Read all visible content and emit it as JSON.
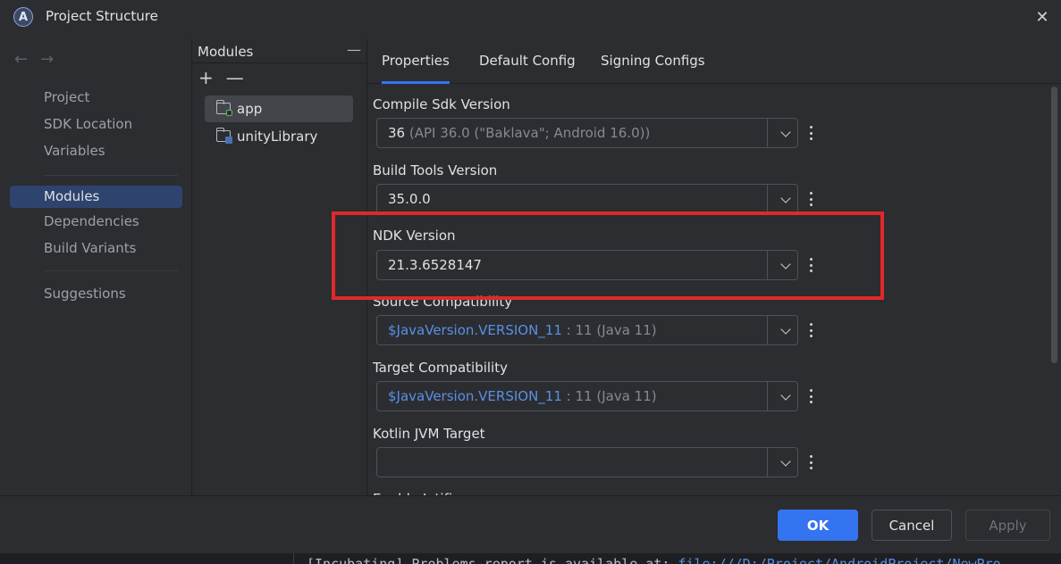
{
  "window": {
    "title": "Project Structure",
    "logo_glyph": "A"
  },
  "nav": {
    "back_glyph": "←",
    "forward_glyph": "→",
    "items": [
      {
        "label": "Project"
      },
      {
        "label": "SDK Location"
      },
      {
        "label": "Variables"
      },
      {
        "label": "Modules",
        "selected": true
      },
      {
        "label": "Dependencies"
      },
      {
        "label": "Build Variants"
      },
      {
        "label": "Suggestions"
      }
    ]
  },
  "modules": {
    "header": "Modules",
    "add_glyph": "+",
    "remove_glyph": "—",
    "minimize_glyph": "—",
    "items": [
      {
        "label": "app",
        "selected": true,
        "icon": "module-folder-icon"
      },
      {
        "label": "unityLibrary",
        "icon": "library-folder-icon"
      }
    ]
  },
  "tabs": [
    {
      "label": "Properties",
      "active": true
    },
    {
      "label": "Default Config"
    },
    {
      "label": "Signing Configs"
    }
  ],
  "fields": {
    "compile_sdk": {
      "label": "Compile Sdk Version",
      "value": "36",
      "hint": "(API 36.0 (\"Baklava\"; Android 16.0))"
    },
    "build_tools": {
      "label": "Build Tools Version",
      "value": "35.0.0"
    },
    "ndk": {
      "label": "NDK Version",
      "value": "21.3.6528147"
    },
    "source_compat": {
      "label": "Source Compatibility",
      "value": "$JavaVersion.VERSION_11",
      "hint": ": 11 (Java 11)"
    },
    "target_compat": {
      "label": "Target Compatibility",
      "value": "$JavaVersion.VERSION_11",
      "hint": ": 11 (Java 11)"
    },
    "kotlin_jvm": {
      "label": "Kotlin JVM Target",
      "value": ""
    },
    "next_label_partial": "Enable Jetifier"
  },
  "footer": {
    "ok": "OK",
    "cancel": "Cancel",
    "apply": "Apply"
  },
  "console": {
    "text": "[Incubating] Problems report is available at: ",
    "link": "file:///D:/Project/AndroidProject/NewPro"
  },
  "colors": {
    "accent": "#3574f0",
    "selection": "#2e436e",
    "highlight_box": "#e0282a",
    "link": "#5a8fe6"
  }
}
